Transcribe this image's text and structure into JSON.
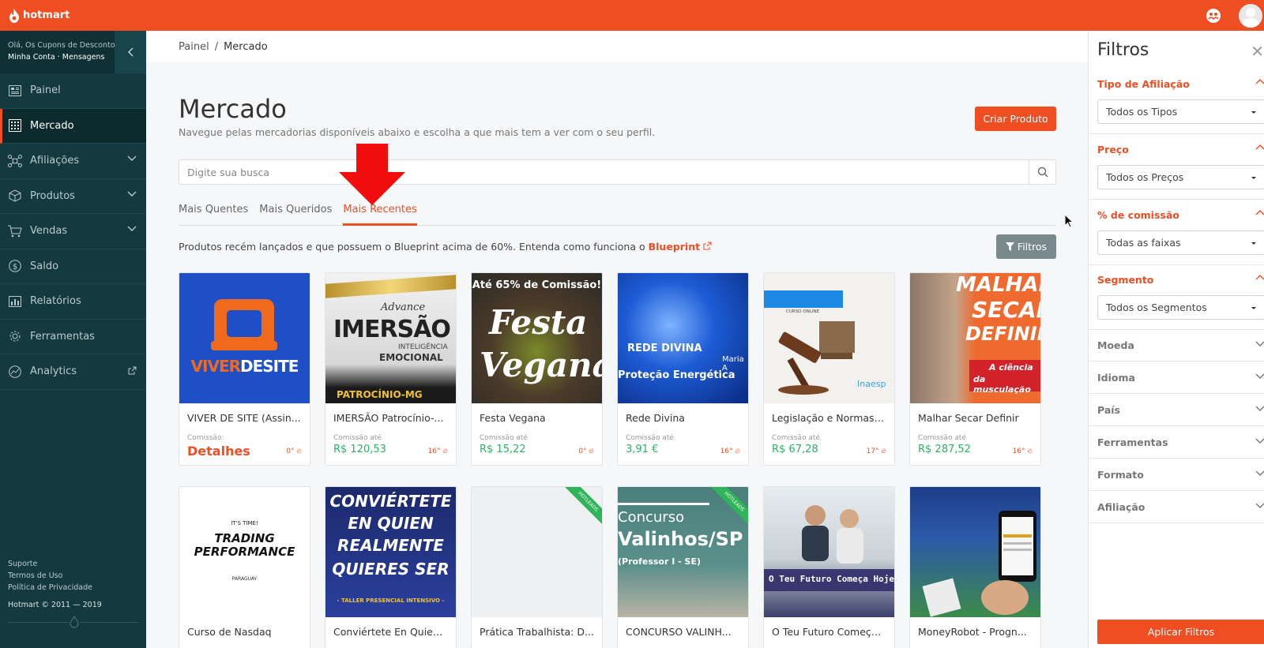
{
  "app": {
    "brand": "hotmart",
    "accent": "#ef4e23",
    "sidebar_bg": "#14393f"
  },
  "user": {
    "greeting": "Olá, Os Cupons de Desconto!",
    "account": "Minha Conta",
    "dot": " · ",
    "messages": "Mensagens"
  },
  "sidebar": {
    "items": [
      {
        "label": "Painel",
        "icon": "dashboard-icon"
      },
      {
        "label": "Mercado",
        "icon": "grid-icon"
      },
      {
        "label": "Afiliações",
        "icon": "network-icon"
      },
      {
        "label": "Produtos",
        "icon": "box-icon"
      },
      {
        "label": "Vendas",
        "icon": "cart-icon"
      },
      {
        "label": "Saldo",
        "icon": "dollar-icon"
      },
      {
        "label": "Relatórios",
        "icon": "chart-icon"
      },
      {
        "label": "Ferramentas",
        "icon": "gear-icon"
      },
      {
        "label": "Analytics",
        "icon": "analytics-icon"
      }
    ],
    "footer": {
      "support": "Suporte",
      "terms": "Termos de Uso",
      "privacy": "Política de Privacidade",
      "copyright": "Hotmart © 2011 — 2019"
    }
  },
  "breadcrumb": {
    "root": "Painel",
    "sep": "/",
    "current": "Mercado"
  },
  "page": {
    "title": "Mercado",
    "subtitle": "Navegue pelas mercadorias disponíveis abaixo e escolha a que mais tem a ver com o seu perfil.",
    "create_button": "Criar Produto",
    "search_placeholder": "Digite sua busca"
  },
  "tabs": [
    "Mais Quentes",
    "Mais Queridos",
    "Mais Recentes"
  ],
  "active_tab": "Mais Recentes",
  "info": {
    "text": "Produtos recém lançados e que possuem o Blueprint acima de 60%. Entenda como funciona o ",
    "link": "Blueprint"
  },
  "filters_button": "Filtros",
  "products_row1": [
    {
      "name": "VIVER DE SITE (Assin...",
      "commission_label": "Comissão:",
      "price": "Detalhes",
      "temp": "0°"
    },
    {
      "name": "IMERSÃO Patrocínio-...",
      "commission_label": "Comissão até",
      "price": "R$ 120,53",
      "temp": "16°"
    },
    {
      "name": "Festa Vegana",
      "commission_label": "Comissão até",
      "price": "R$ 15,22",
      "temp": "0°"
    },
    {
      "name": "Rede Divina",
      "commission_label": "Comissão até",
      "price": "3,91 €",
      "temp": "16°"
    },
    {
      "name": "Legislação e Normas ...",
      "commission_label": "Comissão até",
      "price": "R$ 67,28",
      "temp": "17°"
    },
    {
      "name": "Malhar Secar Definir",
      "commission_label": "Comissão até",
      "price": "R$ 287,52",
      "temp": "16°"
    }
  ],
  "products_row2": [
    {
      "name": "Curso de Nasdaq"
    },
    {
      "name": "Conviértete En Quien ..."
    },
    {
      "name": "Prática Trabalhista: D..."
    },
    {
      "name": "CONCURSO VALINH..."
    },
    {
      "name": "O Teu Futuro Começa..."
    },
    {
      "name": "MoneyRobot - Progn..."
    }
  ],
  "thumb_text": {
    "viver_a": "VIVER",
    "viver_b": "DESITE",
    "imersao_brand": "Advance",
    "imersao_title": "IMERSÃO",
    "imersao_sub1": "INTELIGÊNCIA",
    "imersao_sub2": "EMOCIONAL",
    "imersao_city": "PATROCÍNIO-MG",
    "vegana_top": "Até 65% de Comissão!",
    "vegana_a": "Festa",
    "vegana_b": "Vegana",
    "rede_a": "REDE DIVINA",
    "rede_b": "Proteção Energética",
    "rede_c": "Maria A",
    "leg_tag": "CURSO ONLINE",
    "leg_brand": "Inaesp",
    "malhar_a": "MALHAR",
    "malhar_b": "SECAR",
    "malhar_c": "DEFINIR",
    "malhar_d": "A ciência",
    "malhar_e": "da musculação",
    "trading_a": "IT'S TIME!",
    "trading_b": "TRADING",
    "trading_c": "PERFORMANCE",
    "trading_d": "PARAGUAY",
    "conv_a": "CONVIÉRTETE",
    "conv_b": "EN QUIEN",
    "conv_c": "REALMENTE",
    "conv_d": "QUIERES SER",
    "conv_e": "- TALLER PRESENCIAL INTENSIVO -",
    "conc_a": "Concurso",
    "conc_b": "Valinhos/SP",
    "conc_c": "(Professor I - SE)",
    "futuro": "O Teu Futuro Começa Hoje",
    "ribbon": "HOTLEADS"
  },
  "filters_panel": {
    "title": "Filtros",
    "sections": [
      {
        "title": "Tipo de Afiliação",
        "value": "Todos os Tipos"
      },
      {
        "title": "Preço",
        "value": "Todos os Preços"
      },
      {
        "title": "% de comissão",
        "value": "Todas as faixas"
      },
      {
        "title": "Segmento",
        "value": "Todos os Segmentos"
      }
    ],
    "collapsed": [
      "Moeda",
      "Idioma",
      "País",
      "Ferramentas",
      "Formato",
      "Afiliação"
    ],
    "apply": "Aplicar Filtros"
  }
}
